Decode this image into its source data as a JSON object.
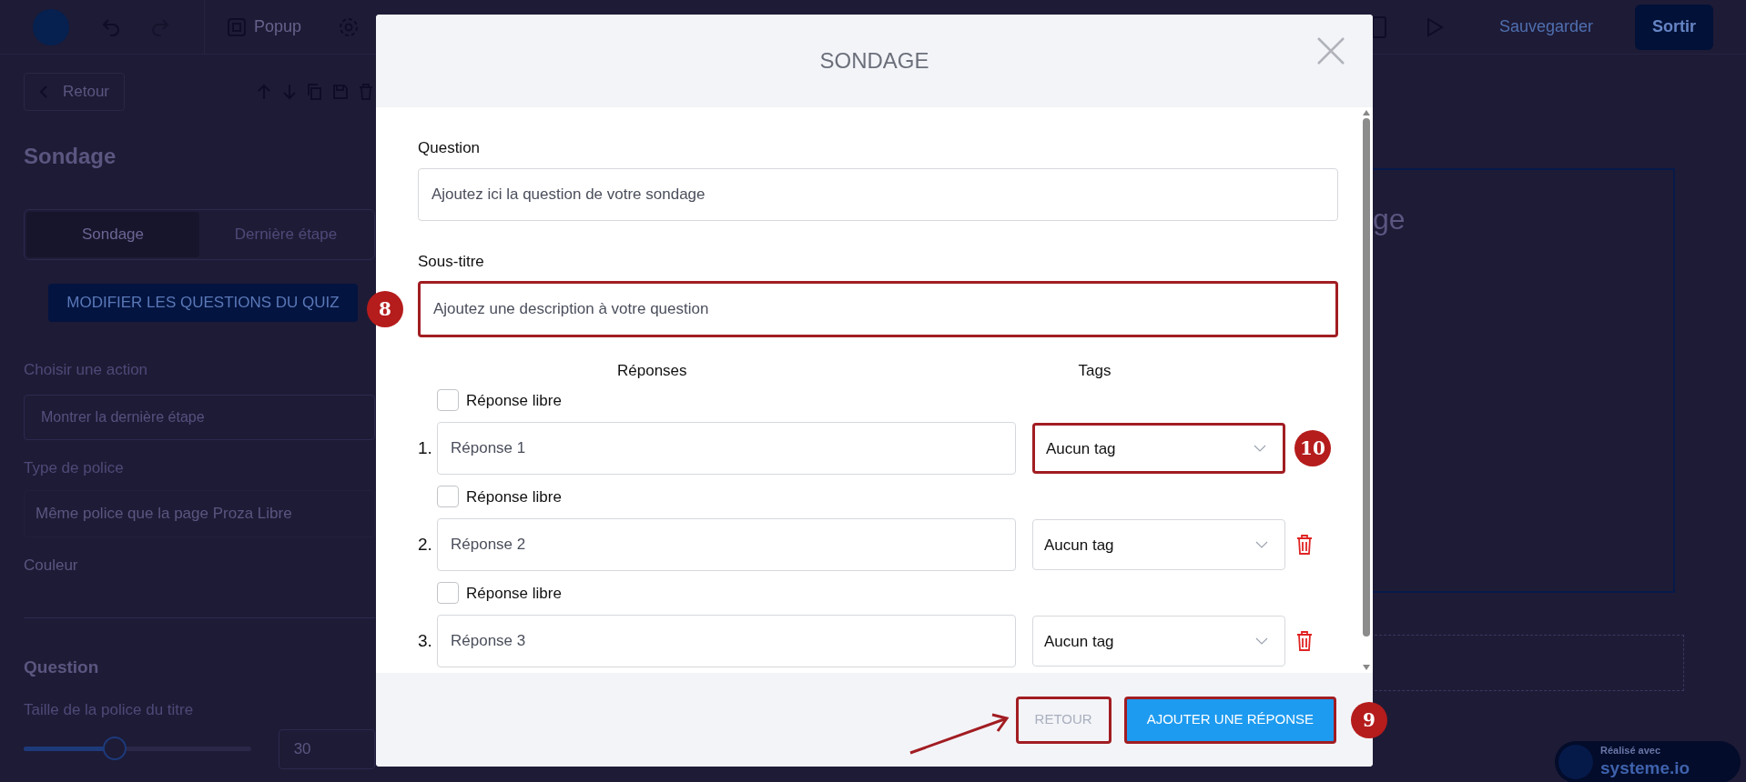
{
  "toolbar": {
    "popup_label": "Popup",
    "save_label": "Sauvegarder",
    "exit_label": "Sortir"
  },
  "sidebar": {
    "back_label": "Retour",
    "title": "Sondage",
    "tabs": [
      {
        "label": "Sondage",
        "selected": true
      },
      {
        "label": "Dernière étape",
        "selected": false
      }
    ],
    "quiz_button": "MODIFIER LES QUESTIONS DU QUIZ",
    "action_label": "Choisir une action",
    "action_value": "Montrer la dernière étape",
    "font_label": "Type de police",
    "font_value": "Même police que la page Proza Libre",
    "color_label": "Couleur",
    "section_title": "Question",
    "size_label": "Taille de la police du titre",
    "size_slider": {
      "level": 0.4
    },
    "size_value": "30"
  },
  "canvas": {
    "heading_fragment": "ge",
    "badge_line1": "Réalisé avec",
    "badge_line2": "systeme.io"
  },
  "dialog": {
    "title": "SONDAGE",
    "question": {
      "label": "Question",
      "placeholder": "Ajoutez ici la question de votre sondage"
    },
    "subtitle": {
      "label": "Sous-titre",
      "placeholder": "Ajoutez une description à votre question",
      "highlighted": true,
      "badge": "8"
    },
    "answers_header": "Réponses",
    "tags_header": "Tags",
    "answers": [
      {
        "number": "1.",
        "free_label": "Réponse libre",
        "free_checked": false,
        "placeholder": "Réponse 1",
        "tag": "Aucun tag",
        "deletable": false,
        "highlighted": true,
        "badge": "10"
      },
      {
        "number": "2.",
        "free_label": "Réponse libre",
        "free_checked": false,
        "placeholder": "Réponse 2",
        "tag": "Aucun tag",
        "deletable": true,
        "highlighted": false
      },
      {
        "number": "3.",
        "free_label": "Réponse libre",
        "free_checked": false,
        "placeholder": "Réponse 3",
        "tag": "Aucun tag",
        "deletable": true,
        "highlighted": false
      }
    ],
    "buttons": [
      {
        "label": "RETOUR",
        "kind": "secondary",
        "disabled": true,
        "highlighted": true,
        "arrow": true
      },
      {
        "label": "AJOUTER UNE RÉPONSE",
        "kind": "primary",
        "disabled": false,
        "highlighted": true,
        "badge": "9"
      }
    ]
  }
}
